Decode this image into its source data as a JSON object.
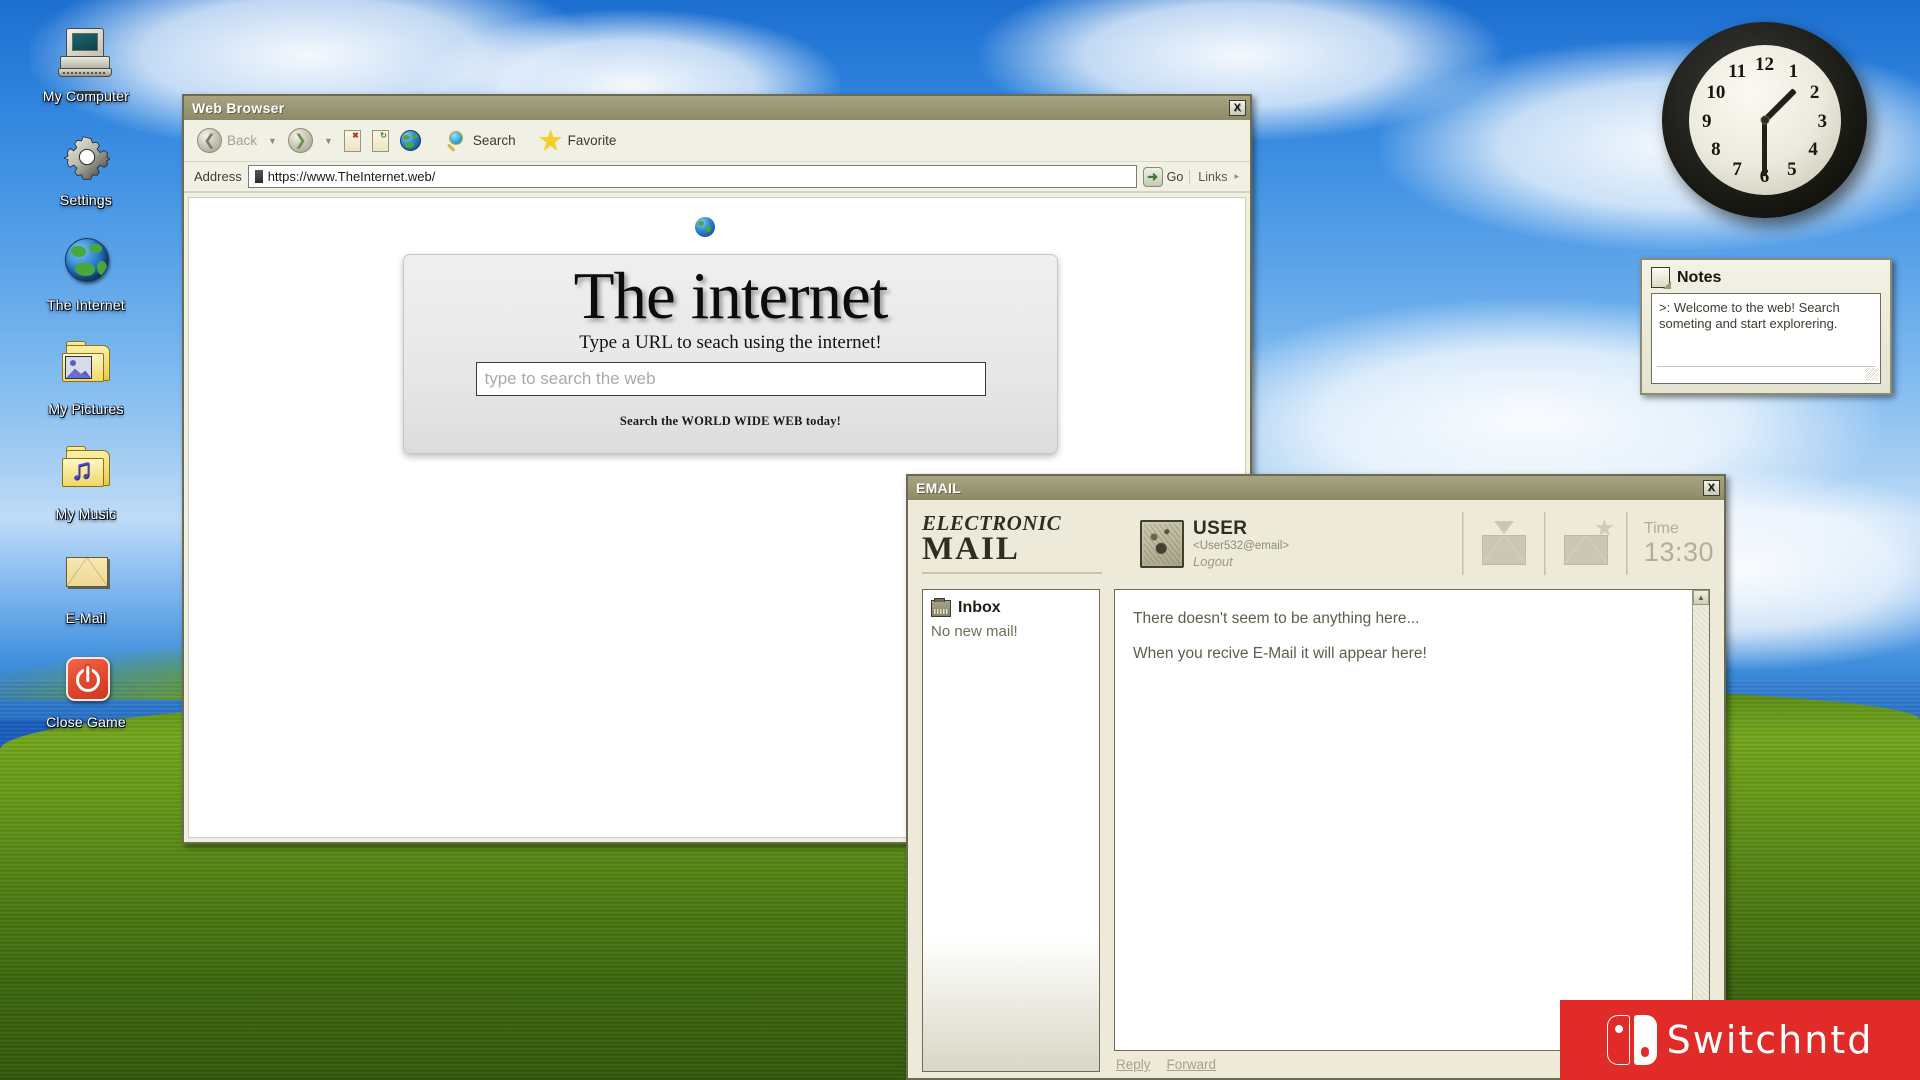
{
  "desktop": {
    "icons": [
      {
        "label": "My Computer",
        "icon": "computer-icon"
      },
      {
        "label": "Settings",
        "icon": "gear-icon"
      },
      {
        "label": "The Internet",
        "icon": "globe-icon"
      },
      {
        "label": "My Pictures",
        "icon": "pictures-folder-icon"
      },
      {
        "label": "My Music",
        "icon": "music-folder-icon"
      },
      {
        "label": "E-Mail",
        "icon": "envelope-icon"
      },
      {
        "label": "Close Game",
        "icon": "power-icon"
      }
    ]
  },
  "browser": {
    "title": "Web Browser",
    "close_label": "X",
    "toolbar": {
      "back_label": "Back",
      "forward_label": "",
      "stop_label": "",
      "refresh_label": "",
      "home_label": "",
      "search_label": "Search",
      "favorite_label": "Favorite"
    },
    "address_bar": {
      "label": "Address",
      "value": "https://www.TheInternet.web/",
      "go_label": "Go",
      "links_label": "Links"
    },
    "page": {
      "title_the": "The",
      "title_internet": "internet",
      "subtitle": "Type a URL to seach using the internet!",
      "search_placeholder": "type to search the web",
      "search_value": "",
      "footer": "Search the WORLD WIDE WEB today!"
    }
  },
  "email": {
    "title": "EMAIL",
    "close_label": "X",
    "brand_line1": "ELECTRONIC",
    "brand_line2": "MAIL",
    "user": {
      "name": "USER",
      "address": "<User532@email>",
      "logout_label": "Logout"
    },
    "time": {
      "label": "Time",
      "value": "13:30"
    },
    "inbox": {
      "title": "Inbox",
      "empty_text": "No new mail!"
    },
    "reader": {
      "line1": "There doesn't seem to be anything here...",
      "line2": "When you recive E-Mail it will appear here!"
    },
    "footer": {
      "reply_label": "Reply",
      "forward_label": "Forward"
    },
    "scroll": {
      "up": "▲",
      "down": "▼"
    }
  },
  "notes": {
    "title": "Notes",
    "text": ">: Welcome to the web! Search someting and start explorering."
  },
  "clock": {
    "numbers": [
      "12",
      "1",
      "2",
      "3",
      "4",
      "5",
      "6",
      "7",
      "8",
      "9",
      "10",
      "11"
    ],
    "hour_angle": 45,
    "minute_angle": 180,
    "displayed_time": "13:30"
  },
  "branding": {
    "text": "Switchntd",
    "color": "#e02b28"
  }
}
